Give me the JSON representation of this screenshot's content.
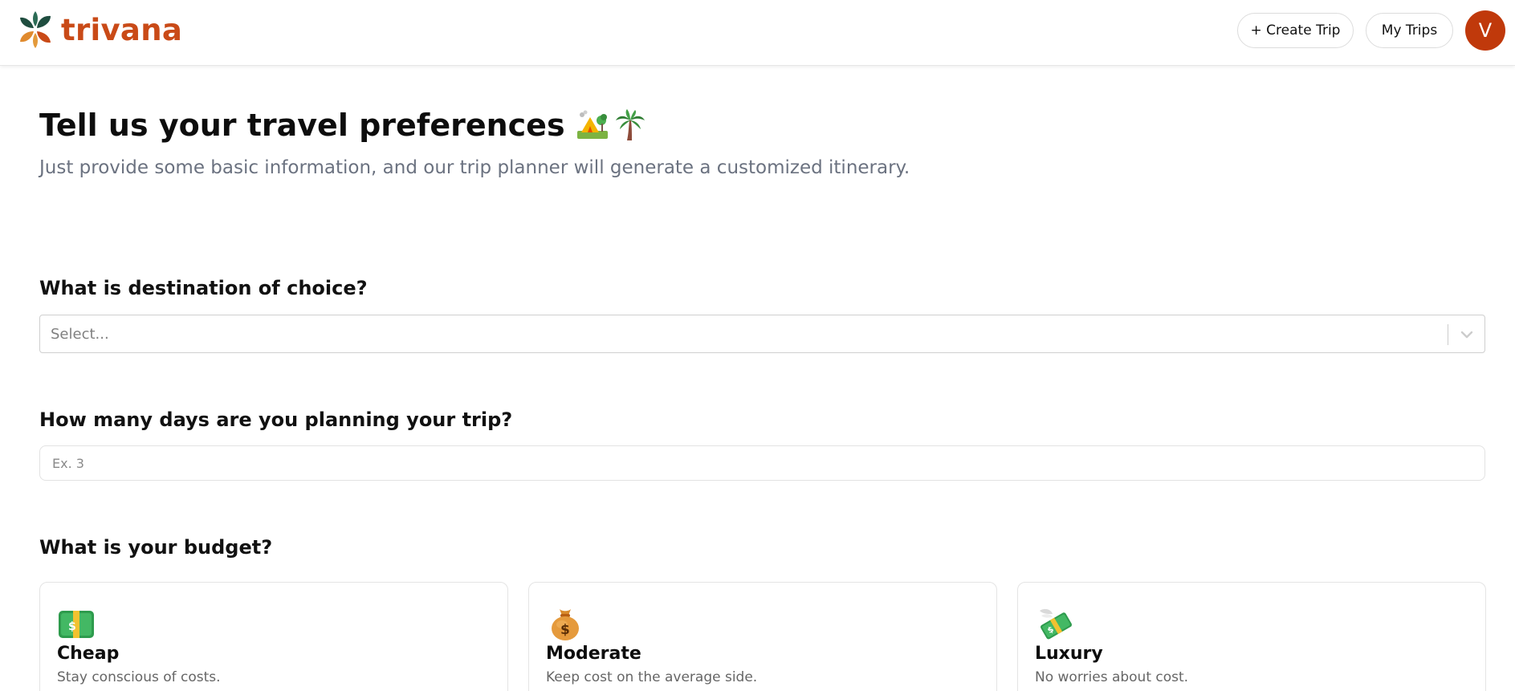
{
  "brand": {
    "name": "trivana",
    "color": "#c94a17"
  },
  "header": {
    "create_trip_label": "+ Create Trip",
    "my_trips_label": "My Trips",
    "avatar_initial": "V",
    "avatar_color": "#c0390b"
  },
  "page": {
    "title": "Tell us your travel preferences",
    "title_icons": [
      "camping-icon",
      "palm-tree-icon"
    ],
    "subtitle": "Just provide some basic information, and our trip planner will generate a customized itinerary."
  },
  "form": {
    "destination": {
      "label": "What is destination of choice?",
      "placeholder": "Select..."
    },
    "days": {
      "label": "How many days are you planning your trip?",
      "placeholder": "Ex. 3",
      "value": ""
    },
    "budget": {
      "label": "What is your budget?",
      "options": [
        {
          "title": "Cheap",
          "description": "Stay conscious of costs.",
          "icon": "dollar-banknote-icon"
        },
        {
          "title": "Moderate",
          "description": "Keep cost on the average side.",
          "icon": "money-bag-icon"
        },
        {
          "title": "Luxury",
          "description": "No worries about cost.",
          "icon": "money-with-wings-icon"
        }
      ]
    }
  }
}
